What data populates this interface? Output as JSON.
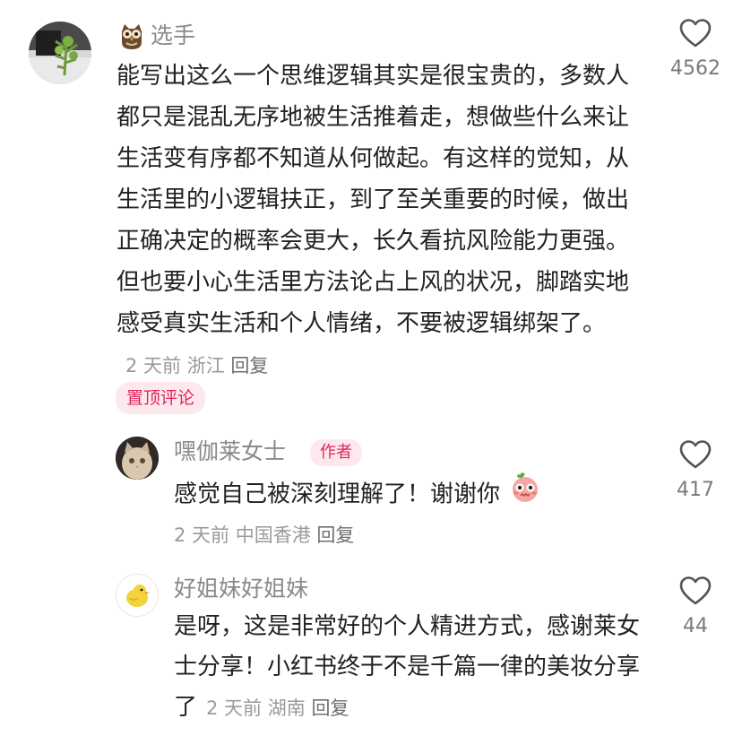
{
  "comment": {
    "user": "选手",
    "text": "能写出这么一个思维逻辑其实是很宝贵的，多数人都只是混乱无序地被生活推着走，想做些什么来让生活变有序都不知道从何做起。有这样的觉知，从生活里的小逻辑扶正，到了至关重要的时候，做出正确决定的概率会更大，长久看抗风险能力更强。但也要小心生活里方法论占上风的状况，脚踏实地感受真实生活和个人情绪，不要被逻辑绑架了。",
    "time": "2 天前",
    "location": "浙江",
    "reply": "回复",
    "likes": "4562",
    "pinned_label": "置顶评论"
  },
  "replies": [
    {
      "user": "嘿伽莱女士",
      "badge": "作者",
      "text": "感觉自己被深刻理解了！谢谢你",
      "time": "2 天前",
      "location": "中国香港",
      "reply": "回复",
      "likes": "417"
    },
    {
      "user": "好姐妹好姐妹",
      "text": "是呀，这是非常好的个人精进方式，感谢莱女士分享！小红书终于不是千篇一律的美妆分享了",
      "time": "2 天前",
      "location": "湖南",
      "reply": "回复",
      "likes": "44"
    }
  ],
  "icons": {
    "like": "heart-icon",
    "owl_badge": "owl-icon",
    "emoji": "blushing-face-emoji"
  },
  "colors": {
    "accent": "#e0245e",
    "badge_bg": "#fde9ed"
  }
}
